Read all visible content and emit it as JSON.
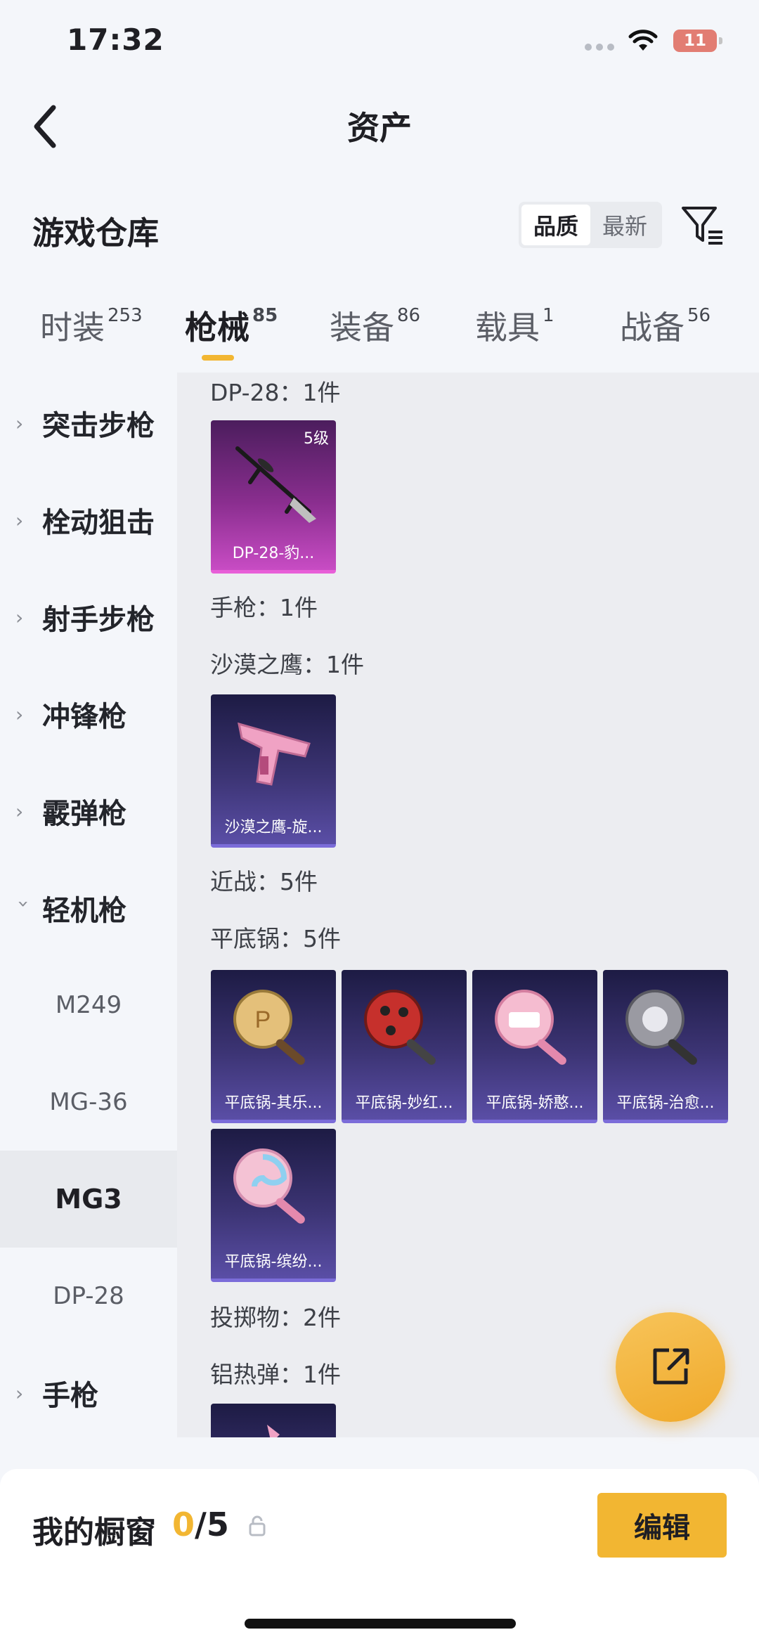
{
  "status_bar": {
    "time": "17:32",
    "battery": "11"
  },
  "header": {
    "title": "资产"
  },
  "warehouse": {
    "title": "游戏仓库",
    "sort_options": [
      "品质",
      "最新"
    ],
    "active_sort": "品质"
  },
  "tabs": [
    {
      "label": "时装",
      "count": "253"
    },
    {
      "label": "枪械",
      "count": "85"
    },
    {
      "label": "装备",
      "count": "86"
    },
    {
      "label": "载具",
      "count": "1"
    },
    {
      "label": "战备",
      "count": "56"
    }
  ],
  "active_tab": "枪械",
  "sidebar": {
    "categories": [
      "突击步枪",
      "栓动狙击",
      "射手步枪",
      "冲锋枪",
      "霰弹枪",
      "轻机枪"
    ],
    "expanded": "轻机枪",
    "subitems": [
      "M249",
      "MG-36",
      "MG3",
      "DP-28"
    ],
    "active_subitem": "MG3",
    "after": [
      "手枪"
    ]
  },
  "content": {
    "groups": [
      {
        "label": "DP-28：1件"
      },
      {
        "label": "手枪：1件"
      },
      {
        "label": "沙漠之鹰：1件"
      },
      {
        "label": "近战：5件"
      },
      {
        "label": "平底锅：5件"
      },
      {
        "label": "投掷物：2件"
      },
      {
        "label": "铝热弹：1件"
      }
    ],
    "cards": {
      "dp28": {
        "name": "DP-28-豹...",
        "level": "5级"
      },
      "deagle": {
        "name": "沙漠之鹰-旋..."
      },
      "pan1": {
        "name": "平底锅-其乐..."
      },
      "pan2": {
        "name": "平底锅-妙红..."
      },
      "pan3": {
        "name": "平底锅-娇憨..."
      },
      "pan4": {
        "name": "平底锅-治愈..."
      },
      "pan5": {
        "name": "平底锅-缤纷..."
      }
    }
  },
  "showcase": {
    "title": "我的橱窗",
    "current": "0",
    "total": "/5",
    "edit_label": "编辑"
  },
  "colors": {
    "accent": "#f2b632",
    "epic": "#8a2e8f",
    "rare": "#3c3474"
  }
}
